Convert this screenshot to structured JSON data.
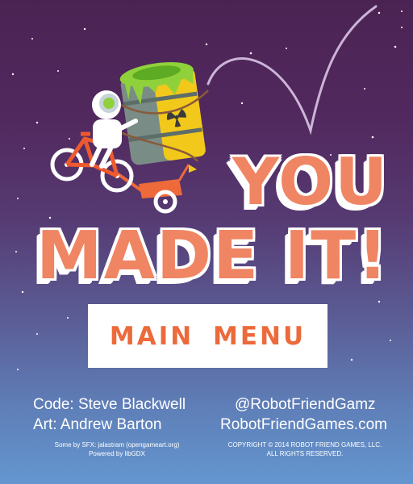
{
  "title": {
    "line1": "YOU",
    "line2": "MADE IT!"
  },
  "menu": {
    "main_menu_label": "MAIN  MENU"
  },
  "credits": {
    "code": "Code: Steve Blackwell",
    "art": "Art: Andrew Barton",
    "sfx": "Some by SFX: jalastram (opengameart.org)",
    "powered": "Powered by libGDX",
    "twitter": "@RobotFriendGamz",
    "website": "RobotFriendGames.com",
    "copyright": "COPYRIGHT © 2014 ROBOT FRIEND GAMES, LLC.",
    "rights": "ALL RIGHTS RESERVED."
  },
  "colors": {
    "accent": "#ef8563",
    "button_text": "#ec6a3b",
    "sky_top": "#4b2353",
    "sky_bottom": "#6496cf",
    "barrel": "#f2c81b",
    "slime": "#8fd13a"
  },
  "sprites": {
    "hero": "robot-astronaut-on-bicycle",
    "cargo": "radioactive-barrel-icon",
    "trailer": "bike-trailer-with-flag"
  }
}
